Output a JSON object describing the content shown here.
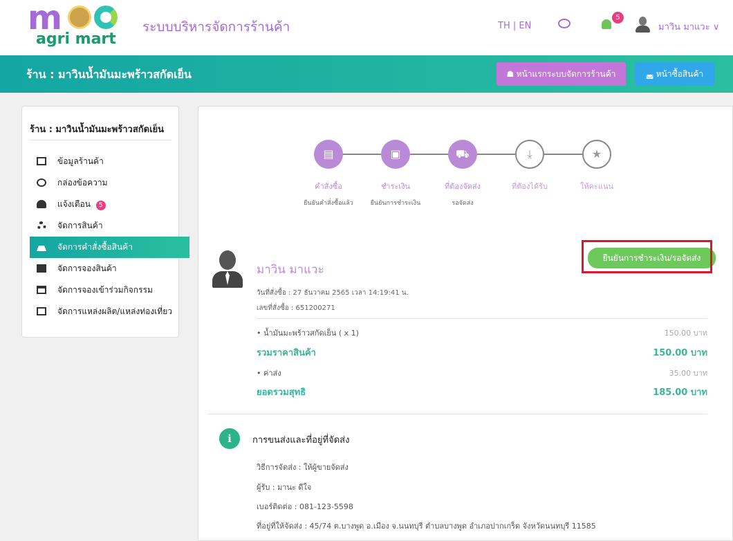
{
  "header": {
    "logo_text": "agri mart",
    "system_name": "ระบบบริหารจัดการร้านค้า",
    "lang_switch": "TH | EN",
    "notification_count": "5",
    "user_name": "มาวิน มาแวะ ∨"
  },
  "band": {
    "shop_title": "ร้าน : มาวินน้ำมันมะพร้าวสกัดเย็น",
    "home_button": "☗ หน้าแรกระบบจัดการร้านค้า",
    "shop_button": "◛ หน้าซื้อสินค้า"
  },
  "sidebar": {
    "title": "ร้าน : มาวินน้ำมันมะพร้าวสกัดเย็น",
    "items": [
      {
        "label": "ข้อมูลร้านค้า",
        "icon": "id-card-icon"
      },
      {
        "label": "กล่องข้อความ",
        "icon": "chat-icon"
      },
      {
        "label": "แจ้งเตือน",
        "icon": "bell-icon",
        "badge": "5"
      },
      {
        "label": "จัดการสินค้า",
        "icon": "boxes-icon"
      },
      {
        "label": "จัดการคำสั่งซื้อสินค้า",
        "icon": "basket-icon",
        "active": true
      },
      {
        "label": "จัดการจองสินค้า",
        "icon": "archive-icon"
      },
      {
        "label": "จัดการจองเข้าร่วมกิจกรรม",
        "icon": "calendar-icon"
      },
      {
        "label": "จัดการแหล่งผลิต/แหล่งท่องเที่ยว",
        "icon": "map-icon"
      }
    ]
  },
  "steps": [
    {
      "label": "คำสั่งซื้อ",
      "sub": "ยืนยันคำสั่งซื้อแล้ว",
      "glyph": "▤",
      "icon": "document-icon",
      "done": true
    },
    {
      "label": "ชำระเงิน",
      "sub": "ยืนยันการชำระเงิน",
      "glyph": "▣",
      "icon": "money-icon",
      "done": true
    },
    {
      "label": "ที่ต้องจัดส่ง",
      "sub": "รอจัดส่ง",
      "glyph": "⛟",
      "icon": "truck-icon",
      "done": true
    },
    {
      "label": "ที่ต้องได้รับ",
      "sub": "",
      "glyph": "⤓",
      "icon": "download-icon",
      "done": false
    },
    {
      "label": "ให้คะแนน",
      "sub": "",
      "glyph": "★",
      "icon": "star-icon",
      "done": false
    }
  ],
  "order": {
    "customer_name": "มาวิน มาแวะ",
    "confirm_button": "ยืนยันการชำระเงิน/รอจัดส่ง",
    "order_date": "วันที่สั่งซื้อ : 27 ธันวาคม 2565 เวลา 14:19:41 น.",
    "order_no": "เลขที่สั่งซื้อ : 651200271",
    "item_label": "• น้ำมันมะพร้าวสกัดเย็น ( x 1)",
    "item_price": "150.00 บาท",
    "subtotal_label": "รวมราคาสินค้า",
    "subtotal_value": "150.00 บาท",
    "shipping_label": "• ค่าส่ง",
    "shipping_value": "35.00 บาท",
    "total_label": "ยอดรวมสุทธิ",
    "total_value": "185.00 บาท"
  },
  "shipping": {
    "title": "การขนส่งและที่อยู่ที่จัดส่ง",
    "method": "วิธีการจัดส่ง : ให้ผู้ขายจัดส่ง",
    "recipient": "ผู้รับ : มานะ ดีใจ",
    "phone": "เบอร์ติดต่อ : 081-123-5598",
    "address": "ที่อยู่ที่ให้จัดส่ง : 45/74 ต.บางพูด อ.เมือง จ.นนทบุรี ตำบลบางพูด อำเภอปากเกร็ด จังหวัดนนทบุรี 11585"
  },
  "colors": {
    "brand_purple": "#a66ad8",
    "teal": "#14a6a2",
    "green": "#6ec95c",
    "highlight_red": "#e0142a"
  }
}
